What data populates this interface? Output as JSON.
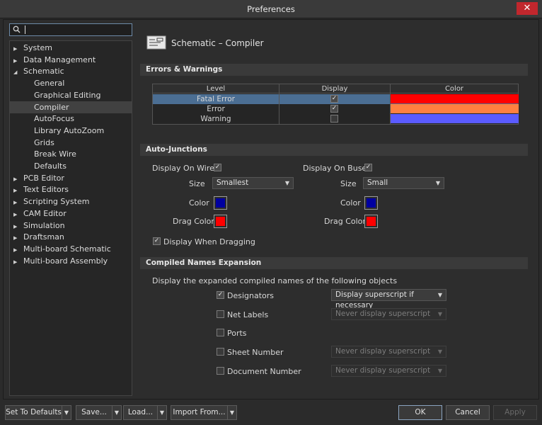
{
  "window": {
    "title": "Preferences",
    "close_glyph": "✕"
  },
  "search": {
    "placeholder": ""
  },
  "tree": [
    {
      "label": "System",
      "level": 0,
      "expander": "▶"
    },
    {
      "label": "Data Management",
      "level": 0,
      "expander": "▶"
    },
    {
      "label": "Schematic",
      "level": 0,
      "expander": "◢"
    },
    {
      "label": "General",
      "level": 1
    },
    {
      "label": "Graphical Editing",
      "level": 1
    },
    {
      "label": "Compiler",
      "level": 1,
      "selected": true
    },
    {
      "label": "AutoFocus",
      "level": 1
    },
    {
      "label": "Library AutoZoom",
      "level": 1
    },
    {
      "label": "Grids",
      "level": 1
    },
    {
      "label": "Break Wire",
      "level": 1
    },
    {
      "label": "Defaults",
      "level": 1
    },
    {
      "label": "PCB Editor",
      "level": 0,
      "expander": "▶"
    },
    {
      "label": "Text Editors",
      "level": 0,
      "expander": "▶"
    },
    {
      "label": "Scripting System",
      "level": 0,
      "expander": "▶"
    },
    {
      "label": "CAM Editor",
      "level": 0,
      "expander": "▶"
    },
    {
      "label": "Simulation",
      "level": 0,
      "expander": "▶"
    },
    {
      "label": "Draftsman",
      "level": 0,
      "expander": "▶"
    },
    {
      "label": "Multi-board Schematic",
      "level": 0,
      "expander": "▶"
    },
    {
      "label": "Multi-board Assembly",
      "level": 0,
      "expander": "▶"
    }
  ],
  "page": {
    "title": "Schematic – Compiler"
  },
  "errors_warnings": {
    "header": "Errors & Warnings",
    "columns": [
      "Level",
      "Display",
      "Color"
    ],
    "rows": [
      {
        "level": "Fatal Error",
        "display": true,
        "color": "#ff0000",
        "selected": true
      },
      {
        "level": "Error",
        "display": true,
        "color": "#ff8040"
      },
      {
        "level": "Warning",
        "display": false,
        "color": "#5b5bff"
      }
    ]
  },
  "auto_junctions": {
    "header": "Auto-Junctions",
    "wires": {
      "label": "Display On Wires",
      "checked": true,
      "size_label": "Size",
      "size": "Smallest",
      "color_label": "Color",
      "color": "#0000a0",
      "drag_color_label": "Drag Color",
      "drag_color": "#ff0000"
    },
    "buses": {
      "label": "Display On Buses",
      "checked": true,
      "size_label": "Size",
      "size": "Small",
      "color_label": "Color",
      "color": "#0000a0",
      "drag_color_label": "Drag Color",
      "drag_color": "#ff0000"
    },
    "when_dragging": {
      "label": "Display When Dragging",
      "checked": true
    }
  },
  "compiled_names": {
    "header": "Compiled Names Expansion",
    "description": "Display the expanded compiled names of the following objects",
    "items": [
      {
        "label": "Designators",
        "checked": true,
        "option": "Display superscript if necessary",
        "enabled": true
      },
      {
        "label": "Net Labels",
        "checked": false,
        "option": "Never display superscript",
        "enabled": false
      },
      {
        "label": "Ports",
        "checked": false,
        "option": ""
      },
      {
        "label": "Sheet Number",
        "checked": false,
        "option": "Never display superscript",
        "enabled": false
      },
      {
        "label": "Document Number",
        "checked": false,
        "option": "Never display superscript",
        "enabled": false
      }
    ]
  },
  "footer": {
    "set_to_defaults": "Set To Defaults",
    "save": "Save...",
    "load": "Load...",
    "import_from": "Import From...",
    "ok": "OK",
    "cancel": "Cancel",
    "apply": "Apply",
    "dropdown_glyph": "▼"
  },
  "glyphs": {
    "check": "✓",
    "dropdown": "▼",
    "search": "⚲"
  }
}
